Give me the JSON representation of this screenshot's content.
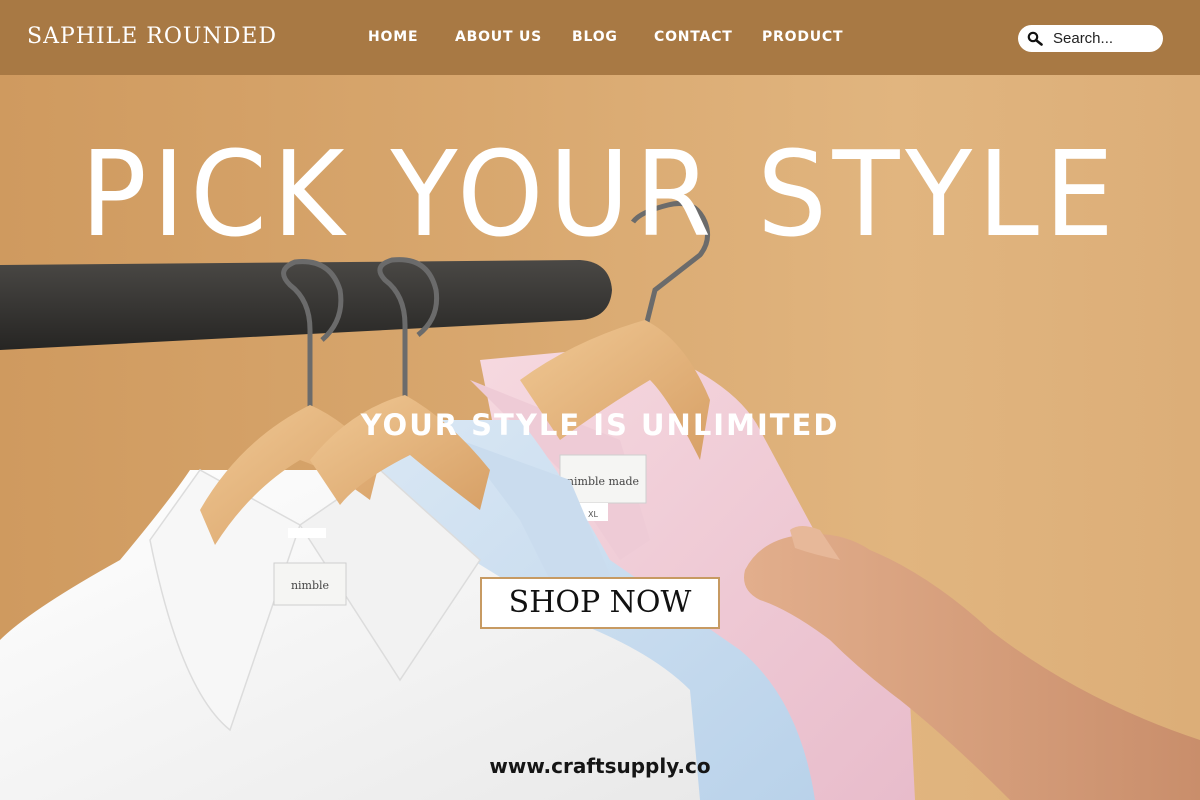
{
  "header": {
    "logo": "SAPHILE ROUNDED",
    "nav": [
      "HOME",
      "ABOUT US",
      "BLOG",
      "CONTACT",
      "PRODUCT"
    ],
    "search_placeholder": "Search..."
  },
  "hero": {
    "title": "PICK YOUR STYLE",
    "subtitle": "YOUR STYLE IS UNLIMITED",
    "cta_label": "SHOP NOW",
    "site_url": "www.craftsupply.co"
  },
  "shirt_labels": {
    "pink_brand": "nimble made",
    "pink_size": "XL",
    "white_brand": "nimble"
  },
  "colors": {
    "header_bg": "#a87944",
    "background": "#d9a870",
    "text_light": "#ffffff",
    "cta_border": "#c79a62"
  },
  "icons": [
    "search-icon"
  ]
}
